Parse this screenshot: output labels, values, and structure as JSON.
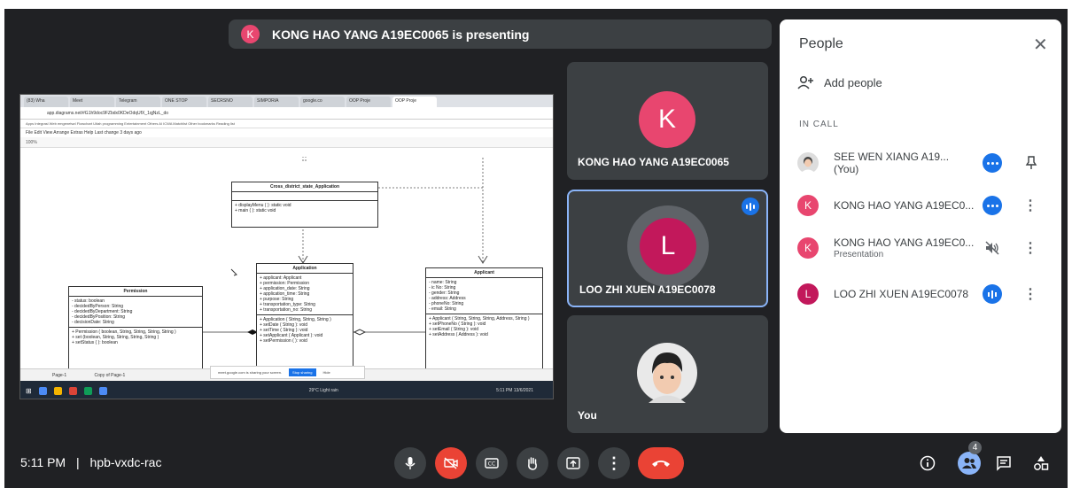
{
  "colors": {
    "accent": "#1a73e8",
    "danger": "#ea4335",
    "avatar_pink": "#e8466f",
    "avatar_red": "#c2185b",
    "tile_bg": "#3c4043"
  },
  "banner": {
    "initial": "K",
    "text": "KONG HAO YANG A19EC0065 is presenting"
  },
  "shared_screen": {
    "tabs": [
      "(83) Wha",
      "Meet",
      "Telegram",
      "ONE STOP",
      "SECRSNO",
      "SIMPORIA",
      "google.co",
      "OOP Proje",
      "OOP Proje"
    ],
    "address": "app.diagrams.net/#G1h9doc9FZbdx0KDeOdqUfX_1qjNzL_do",
    "bookmarks": "Apps   Integrasi Web   emgenetwd   Flowchart   Uitah   programming   Entertainment   Others   AI ICWA   Matchlist   Other bookmarks   Reading list",
    "menu": "File  Edit  View  Arrange  Extras  Help   Last change 3 days ago",
    "toolbar": "100%",
    "classes": {
      "cross": {
        "title": "Cross_district_state_Application",
        "methods": "+ displayMenu ( ): static void\n+ main ( ): static void"
      },
      "application": {
        "title": "Application",
        "attrs": "+ applicant: Applicant\n+ permission: Permission\n+ application_date: String\n+ application_time: String\n+ purpose: String\n+ transportation_type: String\n+ transportation_no: String",
        "methods": "+ Application ( String, String, String )\n+ setDate ( String ): void\n+ setTime ( String ): void\n+ setApplicant ( Applicant ): void\n+ setPermission ( ): void"
      },
      "applicant": {
        "title": "Applicant",
        "attrs": "- name: String\n- ic No: String\n- gender: String\n- address: Address\n- phoneNo: String\n- email: String",
        "methods": "+ Applicant ( String, String, String, Address, String )\n+ setPhoneNo ( String ): void\n+ setEmail ( String ): void\n+ setAddress ( Address ): void"
      },
      "permission": {
        "title": "Permission",
        "attrs": "- status: boolean\n- decidedByPerson: String\n- decidedByDepartment: String\n- decidedByPosition: String\n- decisionDate: String",
        "methods": "+ Permission ( boolean, String, String, String, String )\n+ set (boolean, String, String, String, String )\n+ setStatus ( ): boolean"
      }
    },
    "pages": {
      "page1": "Page-1",
      "page2": "Copy of Page-1"
    },
    "share_bar": {
      "text": "meet.google.com is sharing your screen.",
      "stop": "Stop sharing",
      "hide": "Hide"
    },
    "taskbar": {
      "weather": "29°C  Light rain",
      "time": "5:11 PM",
      "date": "13/6/2021"
    }
  },
  "tiles": [
    {
      "initial": "K",
      "name": "KONG HAO YANG A19EC0065"
    },
    {
      "initial": "L",
      "name": "LOO ZHI XUEN A19EC0078"
    },
    {
      "name": "You"
    }
  ],
  "people": {
    "title": "People",
    "add_people": "Add people",
    "section": "IN CALL",
    "list": [
      {
        "name": "SEE WEN XIANG A19...",
        "tag": "(You)",
        "status": "more-options"
      },
      {
        "initial": "K",
        "name": "KONG HAO YANG A19EC0...",
        "status": "more-options"
      },
      {
        "initial": "K",
        "name": "KONG HAO YANG A19EC0...",
        "sub": "Presentation",
        "status": "muted"
      },
      {
        "initial": "L",
        "name": "LOO ZHI XUEN A19EC0078",
        "status": "speaking"
      }
    ]
  },
  "bottom_bar": {
    "time": "5:11 PM",
    "separator": "|",
    "meeting_code": "hpb-vxdc-rac",
    "participants_count": "4"
  }
}
